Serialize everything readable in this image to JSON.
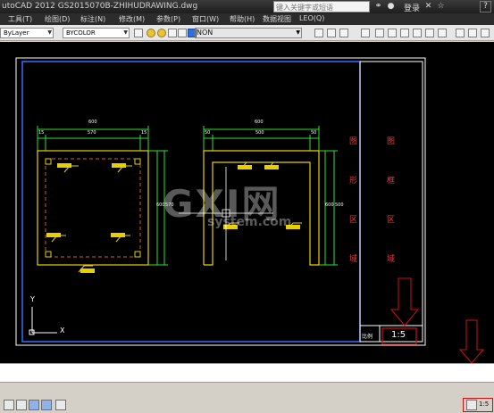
{
  "titlebar": {
    "title": "utoCAD 2012    GS2015070B-ZHIHUDRAWING.dwg",
    "search_placeholder": "键入关键字或短语",
    "login": "登录",
    "help": "?"
  },
  "menu": [
    {
      "label": "工具(T)"
    },
    {
      "label": "绘图(D)"
    },
    {
      "label": "标注(N)"
    },
    {
      "label": "修改(M)"
    },
    {
      "label": "参数(P)"
    },
    {
      "label": "窗口(W)"
    },
    {
      "label": "帮助(H)"
    },
    {
      "label": "数据视图"
    },
    {
      "label": "LEO(Q)"
    }
  ],
  "toolbar": {
    "linetype_value": "ByLayer",
    "color_value": "BYCOLOR",
    "layer_value": "NON"
  },
  "drawing": {
    "front_view": {
      "width_label": "600",
      "inner_width_label": "570",
      "left_margin": "15",
      "right_margin": "15",
      "height_label": "600",
      "inner_height_label": "570"
    },
    "side_view": {
      "width_label": "600",
      "inner_width_label": "500",
      "left_margin": "50",
      "right_margin": "50",
      "height_label": "600",
      "inner_height_label": "500"
    },
    "title_block": {
      "left_column": [
        "图",
        "形",
        "区",
        "域"
      ],
      "right_column": [
        "图",
        "框",
        "区",
        "域"
      ],
      "scale_label": "比例",
      "scale_value": "1:5"
    },
    "ucs": {
      "y_label": "Y",
      "x_label": "X"
    },
    "watermark_main": "GXI网",
    "watermark_sub": "system.com"
  },
  "statusbar": {
    "scale": "1:5"
  },
  "colors": {
    "frame_white": "#ffffff",
    "frame_blue": "#3b6cff",
    "furniture_yellow": "#e8d000",
    "dimension_green": "#2fe02f",
    "dashed_red": "#d45a2a",
    "text_red": "#e23b3b",
    "highlight_red": "#d01010"
  }
}
